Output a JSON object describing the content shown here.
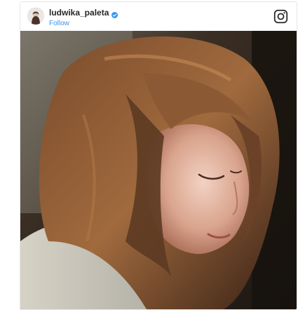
{
  "post": {
    "username": "ludwika_paleta",
    "follow_label": "Follow",
    "verified": true,
    "verified_color": "#3897f0",
    "photo_description_icon": "portrait-photo"
  },
  "icons": {
    "header_right": "instagram-icon",
    "verified": "verified-badge-icon",
    "avatar": "avatar"
  }
}
